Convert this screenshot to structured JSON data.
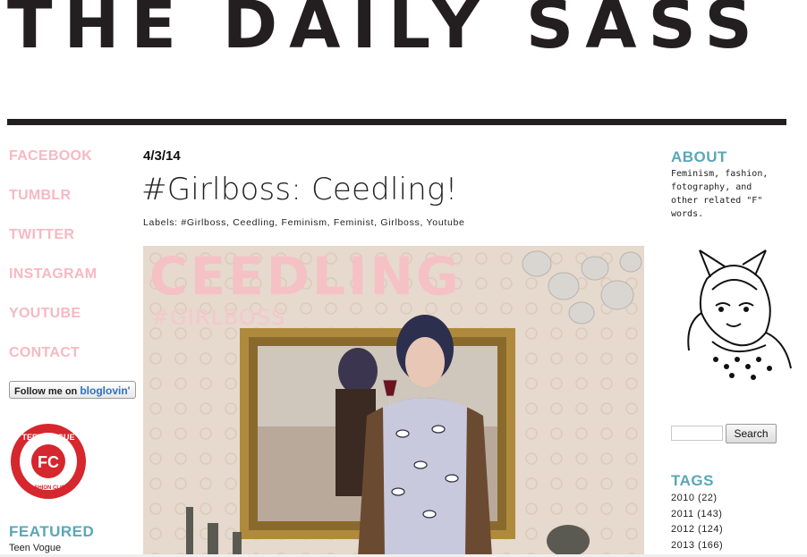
{
  "blog": {
    "title": "THE DAILY SASS"
  },
  "social": [
    {
      "label": "FACEBOOK"
    },
    {
      "label": "TUMBLR"
    },
    {
      "label": "TWITTER"
    },
    {
      "label": "INSTAGRAM"
    },
    {
      "label": "YOUTUBE"
    },
    {
      "label": "CONTACT"
    }
  ],
  "bloglovin": {
    "prefix": "Follow me on",
    "brand": "bloglovin'"
  },
  "badge": {
    "top": "TEEN VOGUE",
    "center": "FC",
    "bottom": "FASHION CLICK"
  },
  "featured": {
    "heading": "FEATURED",
    "items": [
      "Teen Vogue"
    ]
  },
  "post": {
    "date": "4/3/14",
    "title": "#Girlboss: Ceedling!",
    "labels": "Labels: #Girlboss, Ceedling, Feminism, Feminist, Girlboss, Youtube",
    "image": {
      "overlay_title": "CEEDLING",
      "overlay_subtitle": "#GIRLBOSS"
    }
  },
  "about": {
    "heading": "ABOUT",
    "text": "Feminism, fashion, fotography, and other related \"F\" words."
  },
  "search": {
    "button": "Search",
    "value": ""
  },
  "tags": {
    "heading": "TAGS",
    "archive": [
      "2010 (22)",
      "2011 (143)",
      "2012 (124)",
      "2013 (166)"
    ]
  },
  "colors": {
    "pink": "#f7b8c3",
    "teal": "#5aa7b6",
    "dark": "#231f20"
  }
}
